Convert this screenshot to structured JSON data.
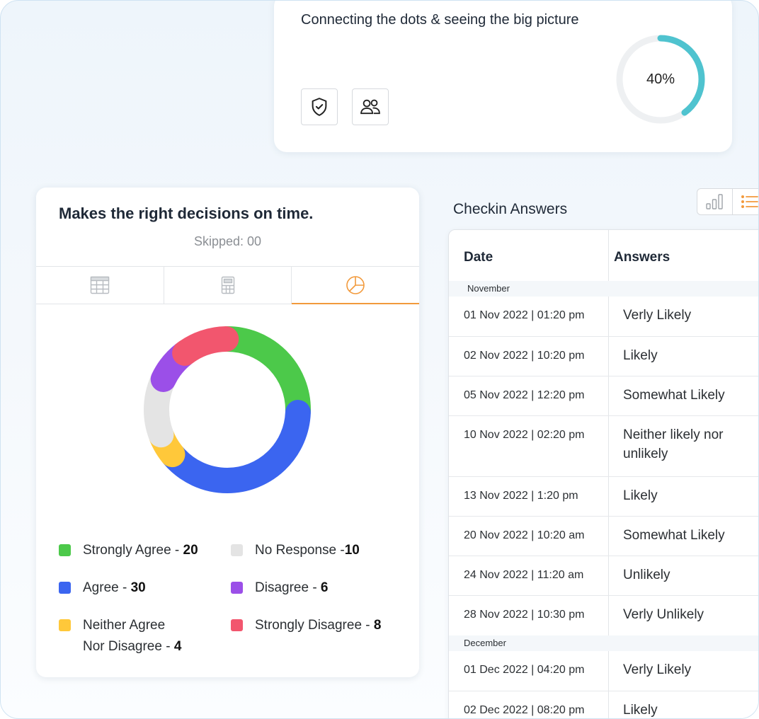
{
  "top_card": {
    "title": "Connecting the dots & seeing the big picture",
    "progress_label": "40%",
    "progress_value": 0.4,
    "progress_color": "#4fc3cf",
    "icons": [
      "shield-check-icon",
      "users-icon"
    ]
  },
  "question_card": {
    "title": "Makes the right decisions on time.",
    "skipped": "Skipped: 00",
    "tabs": [
      {
        "icon": "table-icon",
        "active": false
      },
      {
        "icon": "calculator-icon",
        "active": false
      },
      {
        "icon": "pie-chart-icon",
        "active": true
      }
    ],
    "accent_color": "#f29a3c"
  },
  "chart_data": {
    "type": "pie",
    "donut": true,
    "slices": [
      {
        "label": "Strongly Agree",
        "value": 20,
        "color": "#4cc94a"
      },
      {
        "label": "Agree",
        "value": 30,
        "color": "#3b65f0"
      },
      {
        "label": "Neither Agree Nor Disagree",
        "value": 4,
        "color": "#ffc83a"
      },
      {
        "label": "No Response",
        "value": 10,
        "color": "#e4e4e4"
      },
      {
        "label": "Disagree",
        "value": 6,
        "color": "#9b4fe8"
      },
      {
        "label": "Strongly Disagree",
        "value": 8,
        "color": "#f2566e"
      }
    ],
    "legend": [
      {
        "text": "Strongly Agree - ",
        "value": "20",
        "color": "#4cc94a"
      },
      {
        "text": "No Response -",
        "value": "10",
        "color": "#e4e4e4"
      },
      {
        "text": "Agree - ",
        "value": "30",
        "color": "#3b65f0"
      },
      {
        "text": "Disagree - ",
        "value": "6",
        "color": "#9b4fe8"
      },
      {
        "text": "Neither Agree",
        "text2": "Nor Disagree - ",
        "value": "4",
        "color": "#ffc83a"
      },
      {
        "text": "Strongly Disagree - ",
        "value": "8",
        "color": "#f2566e"
      }
    ]
  },
  "checkin": {
    "title": "Checkin Answers",
    "view_icons": [
      "bar-chart-icon",
      "list-icon"
    ],
    "columns": [
      "Date",
      "Answers"
    ],
    "groups": [
      {
        "name": "November",
        "rows": [
          {
            "date": "01 Nov 2022 | 01:20 pm",
            "answer": "Verly Likely"
          },
          {
            "date": "02 Nov 2022 | 10:20 pm",
            "answer": "Likely"
          },
          {
            "date": "05 Nov 2022 | 12:20 pm",
            "answer": "Somewhat Likely"
          },
          {
            "date": "10 Nov 2022 | 02:20 pm",
            "answer": "Neither likely nor unlikely"
          },
          {
            "date": "13 Nov 2022 | 1:20 pm",
            "answer": "Likely"
          },
          {
            "date": "20 Nov 2022 | 10:20 am",
            "answer": "Somewhat Likely"
          },
          {
            "date": "24 Nov 2022 | 11:20 am",
            "answer": "Unlikely"
          },
          {
            "date": "28 Nov 2022 | 10:30 pm",
            "answer": "Verly Unlikely"
          }
        ]
      },
      {
        "name": "December",
        "rows": [
          {
            "date": "01 Dec 2022 | 04:20 pm",
            "answer": "Verly Likely"
          },
          {
            "date": "02 Dec 2022 | 08:20 pm",
            "answer": "Likely"
          }
        ]
      }
    ]
  }
}
